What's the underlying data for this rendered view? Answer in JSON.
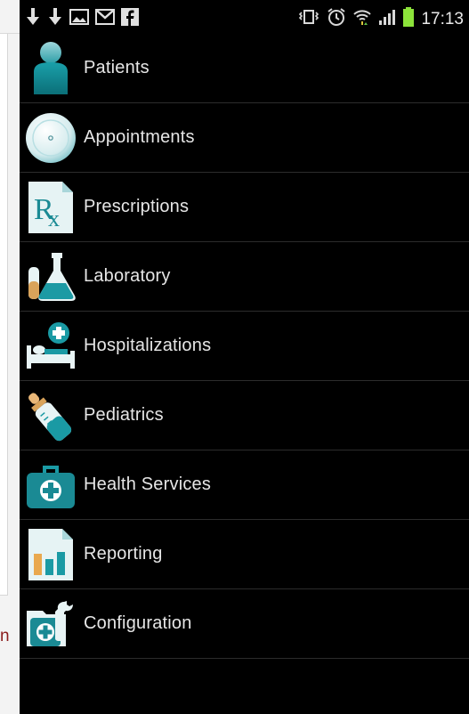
{
  "background": {
    "partial_text": "n"
  },
  "status_bar": {
    "time": "17:13",
    "left_icons": [
      "download-icon",
      "download-icon",
      "gallery-icon",
      "gmail-icon",
      "facebook-icon"
    ],
    "right_icons": [
      "vibrate-icon",
      "alarm-icon",
      "wifi-icon",
      "signal-icon",
      "battery-icon"
    ]
  },
  "menu": {
    "items": [
      {
        "label": "Patients",
        "icon": "patient-icon"
      },
      {
        "label": "Appointments",
        "icon": "clock-icon"
      },
      {
        "label": "Prescriptions",
        "icon": "rx-icon"
      },
      {
        "label": "Laboratory",
        "icon": "lab-flask-icon"
      },
      {
        "label": "Hospitalizations",
        "icon": "hospital-bed-icon"
      },
      {
        "label": "Pediatrics",
        "icon": "baby-bottle-icon"
      },
      {
        "label": "Health Services",
        "icon": "medical-kit-icon"
      },
      {
        "label": "Reporting",
        "icon": "report-chart-icon"
      },
      {
        "label": "Configuration",
        "icon": "settings-folder-icon"
      }
    ]
  },
  "colors": {
    "teal": "#1a8a94",
    "teal_light": "#9fd7dc",
    "battery": "#8ce33a",
    "divider": "#2c2c2c",
    "bg_text": "#8b1c1c"
  }
}
